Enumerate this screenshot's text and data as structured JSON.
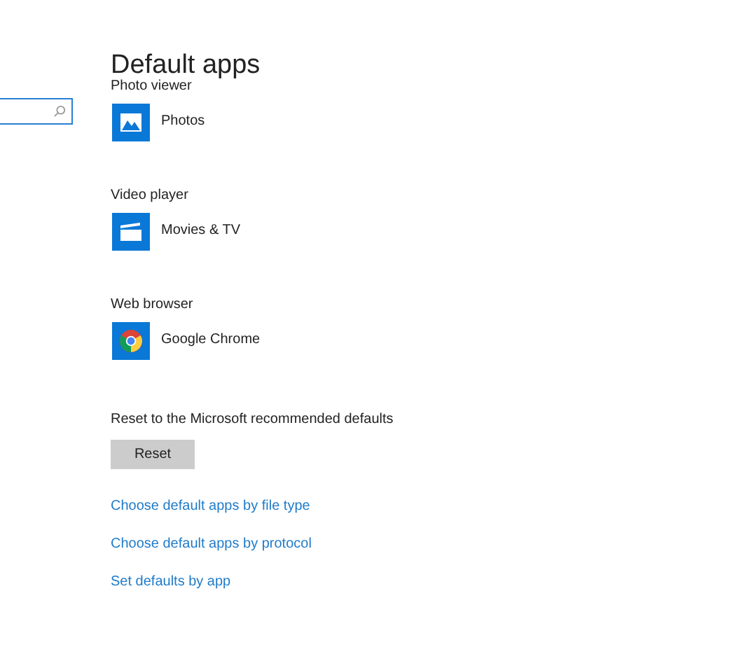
{
  "search": {
    "focused": true
  },
  "title": "Default apps",
  "defaults": [
    {
      "label": "Photo viewer",
      "app": "Photos",
      "kind": "photos"
    },
    {
      "label": "Video player",
      "app": "Movies & TV",
      "kind": "movies"
    },
    {
      "label": "Web browser",
      "app": "Google Chrome",
      "kind": "chrome"
    }
  ],
  "reset": {
    "label": "Reset to the Microsoft recommended defaults",
    "button": "Reset"
  },
  "links": [
    "Choose default apps by file type",
    "Choose default apps by protocol",
    "Set defaults by app"
  ]
}
